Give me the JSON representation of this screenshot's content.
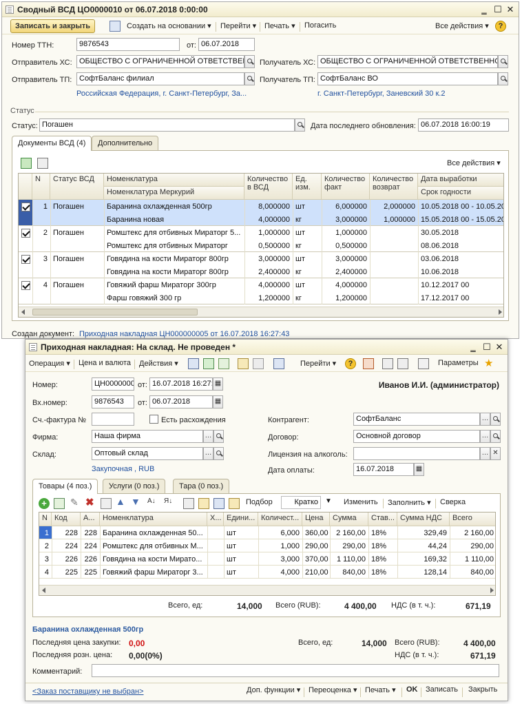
{
  "w1": {
    "title": "Сводный ВСД ЦО0000010 от 06.07.2018 0:00:00",
    "toolbar": {
      "save_close": "Записать и закрыть",
      "create_based": "Создать на основании",
      "go": "Перейти",
      "print": "Печать",
      "cancel": "Погасить",
      "all_actions": "Все действия"
    },
    "ttn_label": "Номер ТТН:",
    "ttn_value": "9876543",
    "from_label": "от:",
    "from_value": "06.07.2018",
    "sender_hs_label": "Отправитель ХС:",
    "sender_hs_value": "ОБЩЕСТВО С ОГРАНИЧЕННОЙ ОТВЕТСТВЕННОСТЬЮ",
    "receiver_hs_label": "Получатель ХС:",
    "receiver_hs_value": "ОБЩЕСТВО С ОГРАНИЧЕННОЙ ОТВЕТСТВЕННОСТЬЮ",
    "sender_tp_label": "Отправитель ТП:",
    "sender_tp_value": "СофтБаланс филиал",
    "receiver_tp_label": "Получатель ТП:",
    "receiver_tp_value": "СофтБаланс ВО",
    "sender_address": "Российская Федерация, г. Санкт-Петербург, За...",
    "receiver_address": "г. Санкт-Петербург, Заневский 30 к.2",
    "status_group": "Статус",
    "status_label": "Статус:",
    "status_value": "Погашен",
    "last_update_label": "Дата последнего обновления:",
    "last_update_value": "06.07.2018 16:00:19",
    "tabs": [
      "Документы ВСД (4)",
      "Дополнительно"
    ],
    "grid_all_actions": "Все действия",
    "headers": {
      "n": "N",
      "status": "Статус ВСД",
      "nom": "Номенклатура",
      "nom_merc": "Номенклатура Меркурий",
      "qty_vsd": "Количество в ВСД",
      "unit": "Ед. изм.",
      "qty_fact": "Количество факт",
      "qty_ret": "Количество возврат",
      "date_prod": "Дата выработки",
      "expiry": "Срок годности"
    },
    "rows": [
      {
        "n": "1",
        "status": "Погашен",
        "nom": "Баранина охлажденная 500гр",
        "merc": "Баранина новая",
        "q1": "8,000000",
        "u1": "шт",
        "f1": "6,000000",
        "r1": "2,000000",
        "d1": "10.05.2018 00 - 10.05.2018",
        "q2": "4,000000",
        "u2": "кг",
        "f2": "3,000000",
        "r2": "1,000000",
        "d2": "15.05.2018 00 - 15.05.2018"
      },
      {
        "n": "2",
        "status": "Погашен",
        "nom": "Ромштекс для отбивных Мираторг 5...",
        "merc": "Ромштекс для отбивных Мираторг",
        "q1": "1,000000",
        "u1": "шт",
        "f1": "1,000000",
        "r1": "",
        "d1": "30.05.2018",
        "q2": "0,500000",
        "u2": "кг",
        "f2": "0,500000",
        "r2": "",
        "d2": "08.06.2018"
      },
      {
        "n": "3",
        "status": "Погашен",
        "nom": "Говядина на кости Мираторг 800гр",
        "merc": "Говядина на кости Мираторг 800гр",
        "q1": "3,000000",
        "u1": "шт",
        "f1": "3,000000",
        "r1": "",
        "d1": "03.06.2018",
        "q2": "2,400000",
        "u2": "кг",
        "f2": "2,400000",
        "r2": "",
        "d2": "10.06.2018"
      },
      {
        "n": "4",
        "status": "Погашен",
        "nom": "Говяжий фарш Мираторг 300гр",
        "merc": "Фарш говяжий 300 гр",
        "q1": "4,000000",
        "u1": "шт",
        "f1": "4,000000",
        "r1": "",
        "d1": "10.12.2017 00",
        "q2": "1,200000",
        "u2": "кг",
        "f2": "1,200000",
        "r2": "",
        "d2": "17.12.2017 00"
      }
    ],
    "created_label": "Создан документ:",
    "created_value": "Приходная накладная ЦН000000005 от 16.07.2018 16:27:43"
  },
  "w2": {
    "title": "Приходная накладная: На склад. Не проведен *",
    "toolbar": {
      "operation": "Операция",
      "price": "Цена и валюта",
      "actions": "Действия",
      "go": "Перейти",
      "params": "Параметры"
    },
    "num_label": "Номер:",
    "num_value": "ЦН000000005",
    "from_label": "от:",
    "from_value": "16.07.2018 16:27:43",
    "user": "Иванов И.И. (администратор)",
    "inc_label": "Вх.номер:",
    "inc_value": "9876543",
    "inc_from_label": "от:",
    "inc_from_value": "06.07.2018",
    "invoice_label": "Сч.-фактура №",
    "discrepancy_label": "Есть расхождения",
    "contractor_label": "Контрагент:",
    "contractor_value": "СофтБаланс",
    "firm_label": "Фирма:",
    "firm_value": "Наша фирма",
    "contract_label": "Договор:",
    "contract_value": "Основной договор",
    "warehouse_label": "Склад:",
    "warehouse_value": "Оптовый склад",
    "license_label": "Лицензия на алкоголь:",
    "license_value": "",
    "price_type": "Закупочная , RUB",
    "pay_date_label": "Дата оплаты:",
    "pay_date_value": "16.07.2018",
    "tabs": [
      "Товары (4 поз.)",
      "Услуги (0 поз.)",
      "Тара (0 поз.)"
    ],
    "grid_toolbar": {
      "select": "Подбор",
      "brief": "Кратко",
      "change": "Изменить",
      "fill": "Заполнить",
      "check": "Сверка"
    },
    "headers": {
      "n": "N",
      "code": "Код",
      "art": "А...",
      "nom": "Номенклатура",
      "x": "Х...",
      "unit": "Едини...",
      "qty": "Количест...",
      "price": "Цена",
      "sum": "Сумма",
      "rate": "Став...",
      "vat": "Сумма НДС",
      "total": "Всего"
    },
    "rows": [
      {
        "n": "1",
        "code": "228",
        "art": "228",
        "nom": "Баранина охлажденная 50...",
        "unit": "шт",
        "qty": "6,000",
        "price": "360,00",
        "sum": "2 160,00",
        "rate": "18%",
        "vat": "329,49",
        "total": "2 160,00"
      },
      {
        "n": "2",
        "code": "224",
        "art": "224",
        "nom": "Ромштекс для отбивных М...",
        "unit": "шт",
        "qty": "1,000",
        "price": "290,00",
        "sum": "290,00",
        "rate": "18%",
        "vat": "44,24",
        "total": "290,00"
      },
      {
        "n": "3",
        "code": "226",
        "art": "226",
        "nom": "Говядина на кости Мирато...",
        "unit": "шт",
        "qty": "3,000",
        "price": "370,00",
        "sum": "1 110,00",
        "rate": "18%",
        "vat": "169,32",
        "total": "1 110,00"
      },
      {
        "n": "4",
        "code": "225",
        "art": "225",
        "nom": "Говяжий фарш Мираторг 3...",
        "unit": "шт",
        "qty": "4,000",
        "price": "210,00",
        "sum": "840,00",
        "rate": "18%",
        "vat": "128,14",
        "total": "840,00"
      }
    ],
    "totals": {
      "qty_label": "Всего, ед:",
      "qty": "14,000",
      "rub_label": "Всего (RUB):",
      "rub": "4 400,00",
      "vat_label": "НДС (в т. ч.):",
      "vat": "671,19"
    },
    "item_name": "Баранина охлажденная 500гр",
    "last_purchase_label": "Последняя цена закупки:",
    "last_purchase_value": "0,00",
    "last_retail_label": "Последняя розн. цена:",
    "last_retail_value": "0,00(0%)",
    "sum2": {
      "qty_label": "Всего, ед:",
      "qty": "14,000",
      "rub_label": "Всего (RUB):",
      "rub": "4 400,00",
      "vat_label": "НДС (в т. ч.):",
      "vat": "671,19"
    },
    "comment_label": "Комментарий:",
    "comment_value": "",
    "footer": {
      "order_link": "<Заказ поставщику не выбран>",
      "extra": "Доп. функции",
      "reprice": "Переоценка",
      "print": "Печать",
      "ok": "OK",
      "save": "Записать",
      "close": "Закрыть"
    }
  }
}
